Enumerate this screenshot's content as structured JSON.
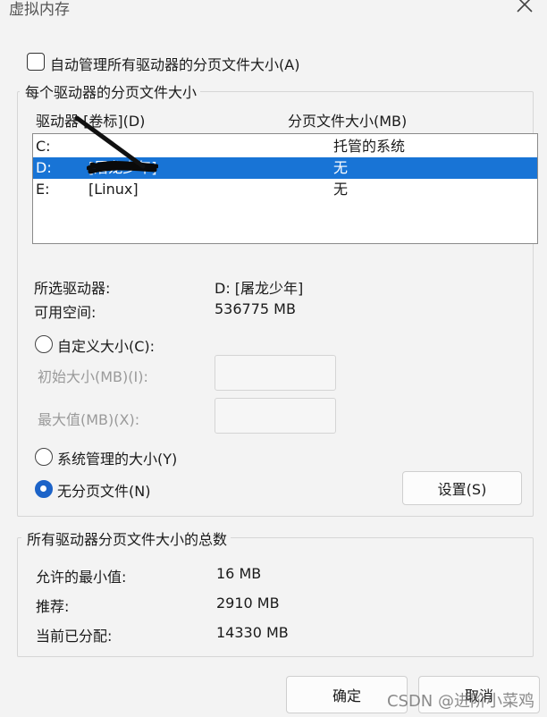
{
  "window": {
    "title": "虚拟内存"
  },
  "auto_manage": {
    "label": "自动管理所有驱动器的分页文件大小(A)",
    "checked": false
  },
  "group1": {
    "legend": "每个驱动器的分页文件大小",
    "col_drive": "驱动器 [卷标](D)",
    "col_size": "分页文件大小(MB)",
    "drives": [
      {
        "letter": "C:",
        "label": "",
        "size": "托管的系统"
      },
      {
        "letter": "D:",
        "label": "[屠龙少年]",
        "size": "无",
        "selected": true
      },
      {
        "letter": "E:",
        "label": "[Linux]",
        "size": "无"
      }
    ],
    "selected_drive_label": "所选驱动器:",
    "selected_drive_value": "D:  [屠龙少年]",
    "free_space_label": "可用空间:",
    "free_space_value": "536775 MB",
    "custom_size_label": "自定义大小(C):",
    "initial_size_label": "初始大小(MB)(I):",
    "max_size_label": "最大值(MB)(X):",
    "system_managed_label": "系统管理的大小(Y)",
    "no_paging_label": "无分页文件(N)",
    "set_button": "设置(S)"
  },
  "group2": {
    "legend": "所有驱动器分页文件大小的总数",
    "min_label": "允许的最小值:",
    "min_value": "16 MB",
    "recommended_label": "推荐:",
    "recommended_value": "2910 MB",
    "allocated_label": "当前已分配:",
    "allocated_value": "14330 MB"
  },
  "buttons": {
    "ok": "确定",
    "cancel": "取消"
  },
  "watermark": "CSDN @进阶小菜鸡",
  "colors": {
    "selection": "#1874d6",
    "radio_on": "#1c63c8"
  }
}
